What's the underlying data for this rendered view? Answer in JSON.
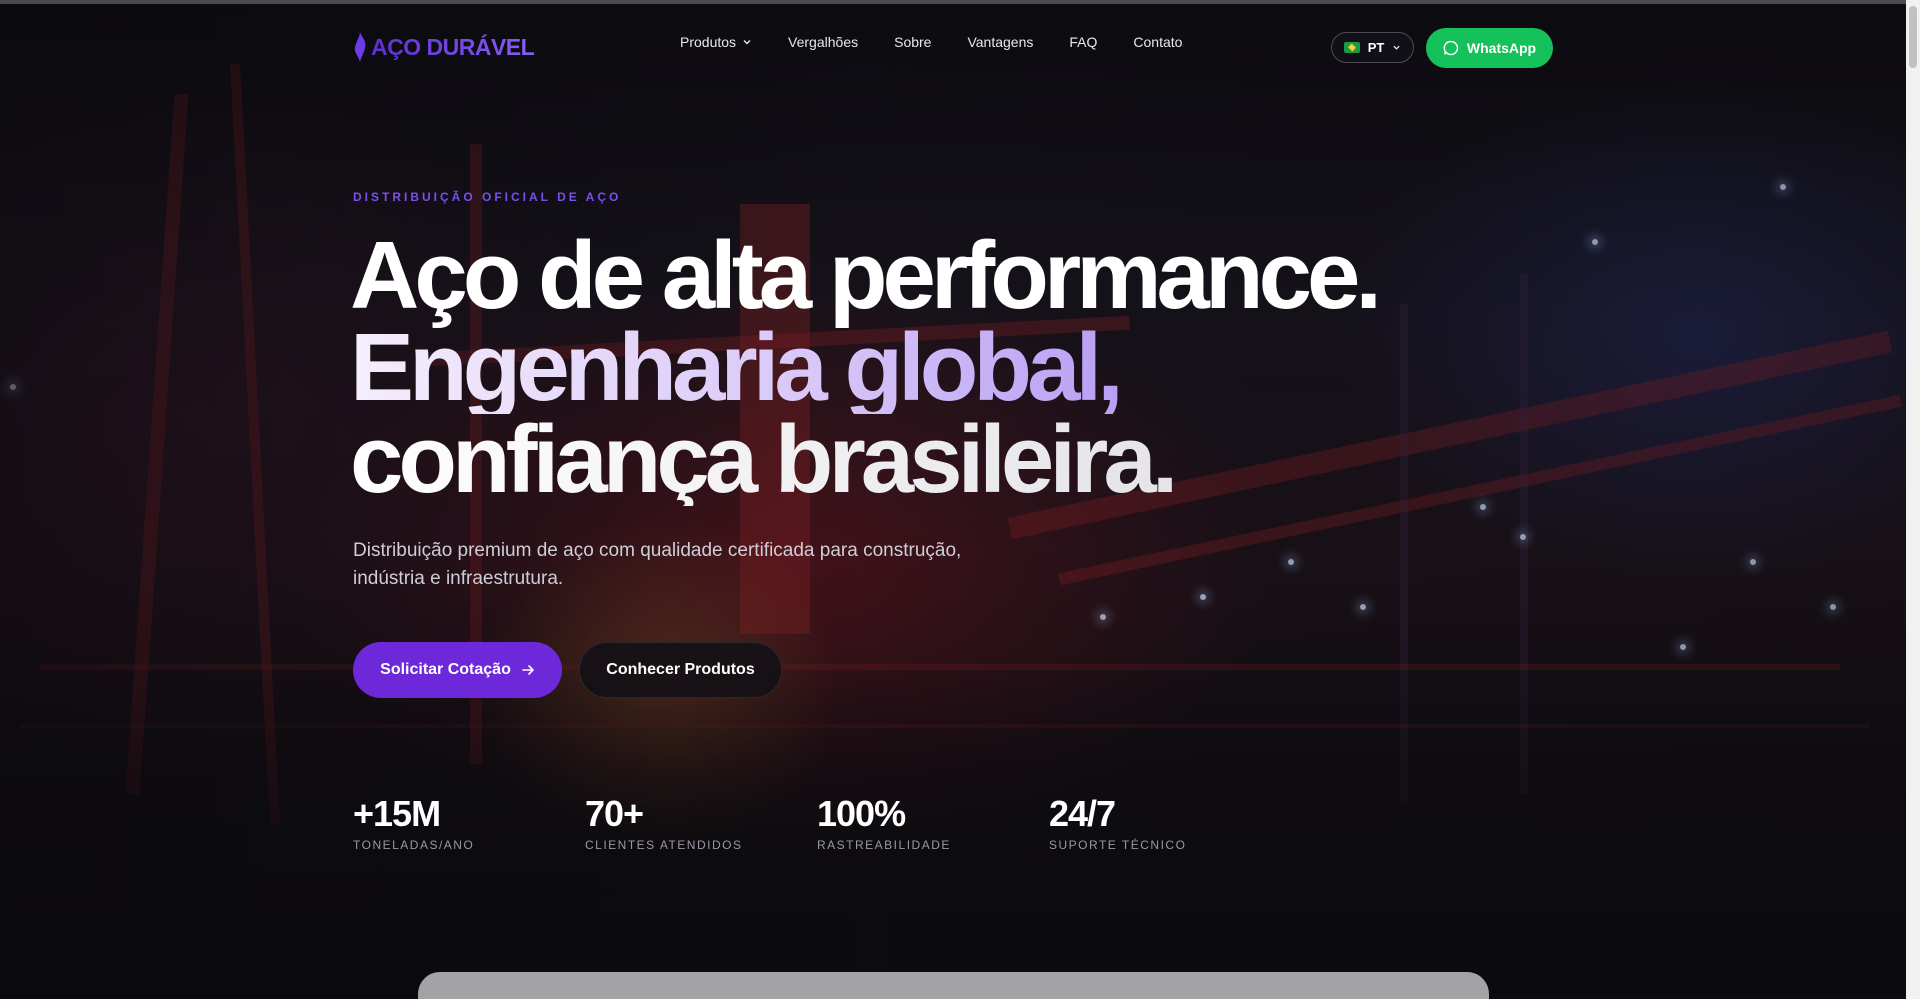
{
  "nav": {
    "logo_text": "AÇO DURÁVEL",
    "links": [
      {
        "label": "Produtos",
        "has_dropdown": true
      },
      {
        "label": "Vergalhões"
      },
      {
        "label": "Sobre"
      },
      {
        "label": "Vantagens"
      },
      {
        "label": "FAQ"
      },
      {
        "label": "Contato"
      }
    ],
    "language": "PT",
    "whatsapp_label": "WhatsApp"
  },
  "hero": {
    "eyebrow": "DISTRIBUIÇÃO OFICIAL DE AÇO",
    "headline_line1": "Aço de alta performance.",
    "headline_line2": "Engenharia global,",
    "headline_line3": "confiança brasileira.",
    "subtitle": "Distribuição premium de aço com qualidade certificada para construção, indústria e infraestrutura.",
    "primary_cta": "Solicitar Cotação",
    "secondary_cta": "Conhecer Produtos"
  },
  "stats": [
    {
      "value": "+15M",
      "label": "TONELADAS/ANO"
    },
    {
      "value": "70+",
      "label": "CLIENTES ATENDIDOS"
    },
    {
      "value": "100%",
      "label": "RASTREABILIDADE"
    },
    {
      "value": "24/7",
      "label": "SUPORTE TÉCNICO"
    }
  ],
  "colors": {
    "accent": "#6d28d9",
    "whatsapp": "#14c15b",
    "eyebrow": "#7b4ef0",
    "background": "#0c0b10"
  },
  "icons": {
    "logo": "flame-logo-icon",
    "dropdown": "chevron-down-icon",
    "whatsapp": "whatsapp-chat-icon",
    "cta": "arrow-right-icon",
    "flag": "brazil-flag-icon"
  }
}
